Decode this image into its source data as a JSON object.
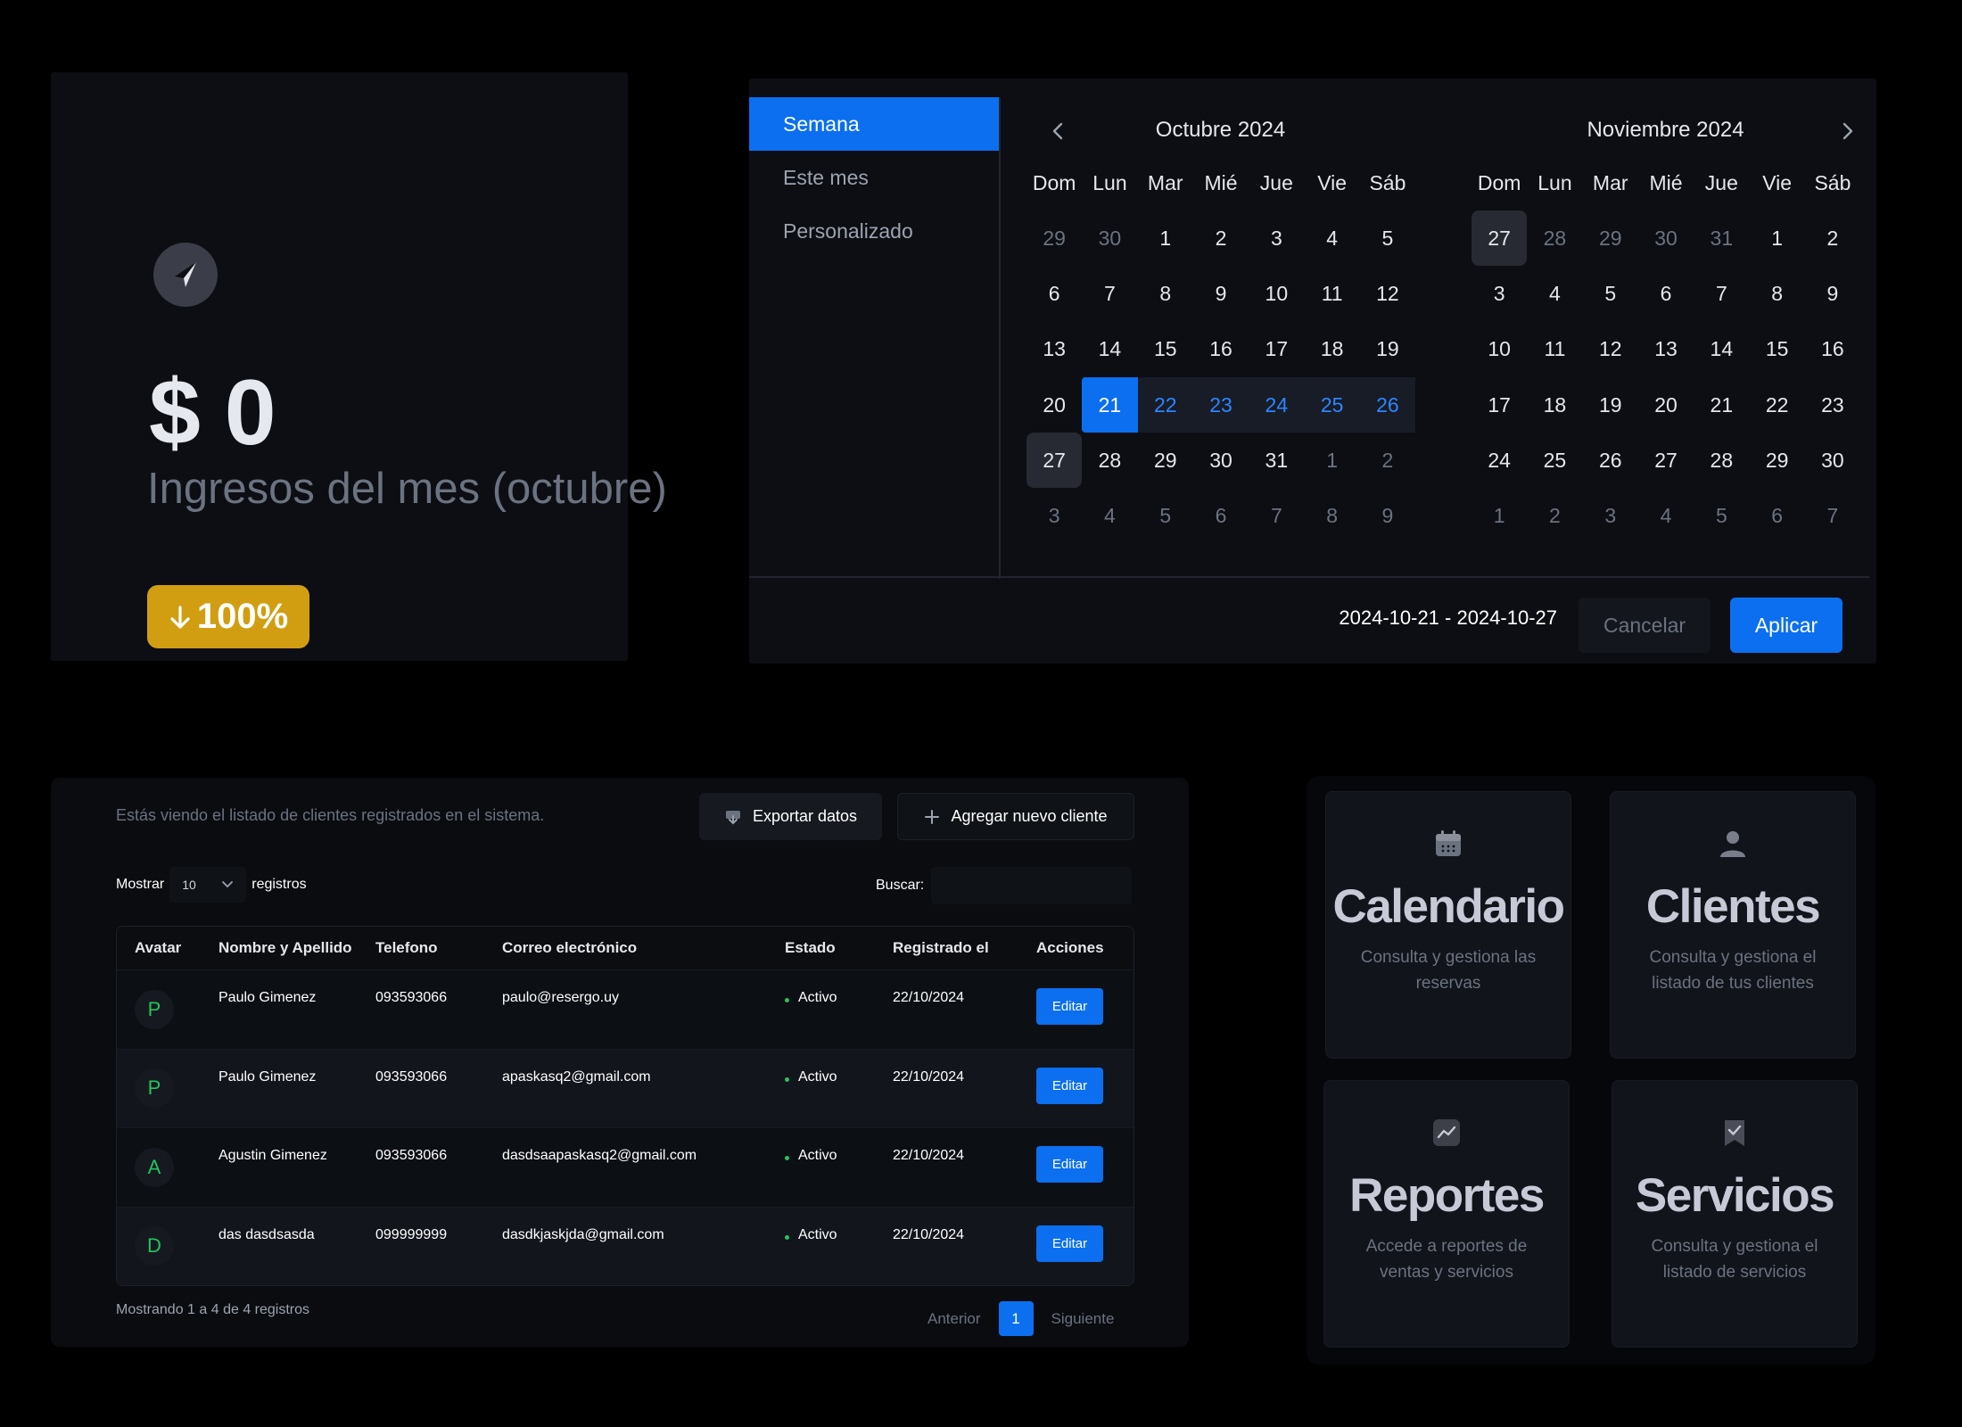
{
  "income": {
    "amount": "$ 0",
    "label": "Ingresos del mes (octubre)",
    "change": "100%",
    "change_direction": "down",
    "badge_color": "#d19e12"
  },
  "date_picker": {
    "presets": [
      {
        "label": "Semana",
        "active": true
      },
      {
        "label": "Este mes",
        "active": false
      },
      {
        "label": "Personalizado",
        "active": false
      }
    ],
    "weekdays": [
      "Dom",
      "Lun",
      "Mar",
      "Mié",
      "Jue",
      "Vie",
      "Sáb"
    ],
    "months": [
      {
        "title": "Octubre 2024",
        "weeks": [
          [
            {
              "d": "29",
              "s": "out"
            },
            {
              "d": "30",
              "s": "out"
            },
            {
              "d": "1"
            },
            {
              "d": "2"
            },
            {
              "d": "3"
            },
            {
              "d": "4"
            },
            {
              "d": "5"
            }
          ],
          [
            {
              "d": "6"
            },
            {
              "d": "7"
            },
            {
              "d": "8"
            },
            {
              "d": "9"
            },
            {
              "d": "10"
            },
            {
              "d": "11"
            },
            {
              "d": "12"
            }
          ],
          [
            {
              "d": "13"
            },
            {
              "d": "14"
            },
            {
              "d": "15"
            },
            {
              "d": "16"
            },
            {
              "d": "17"
            },
            {
              "d": "18"
            },
            {
              "d": "19"
            }
          ],
          [
            {
              "d": "20"
            },
            {
              "d": "21",
              "s": "sel"
            },
            {
              "d": "22",
              "s": "range"
            },
            {
              "d": "23",
              "s": "range"
            },
            {
              "d": "24",
              "s": "range"
            },
            {
              "d": "25",
              "s": "range"
            },
            {
              "d": "26",
              "s": "range"
            }
          ],
          [
            {
              "d": "27",
              "s": "today"
            },
            {
              "d": "28"
            },
            {
              "d": "29"
            },
            {
              "d": "30"
            },
            {
              "d": "31"
            },
            {
              "d": "1",
              "s": "out"
            },
            {
              "d": "2",
              "s": "out"
            }
          ],
          [
            {
              "d": "3",
              "s": "out"
            },
            {
              "d": "4",
              "s": "out"
            },
            {
              "d": "5",
              "s": "out"
            },
            {
              "d": "6",
              "s": "out"
            },
            {
              "d": "7",
              "s": "out"
            },
            {
              "d": "8",
              "s": "out"
            },
            {
              "d": "9",
              "s": "out"
            }
          ]
        ]
      },
      {
        "title": "Noviembre 2024",
        "weeks": [
          [
            {
              "d": "27",
              "s": "today"
            },
            {
              "d": "28",
              "s": "out"
            },
            {
              "d": "29",
              "s": "out"
            },
            {
              "d": "30",
              "s": "out"
            },
            {
              "d": "31",
              "s": "out"
            },
            {
              "d": "1"
            },
            {
              "d": "2"
            }
          ],
          [
            {
              "d": "3"
            },
            {
              "d": "4"
            },
            {
              "d": "5"
            },
            {
              "d": "6"
            },
            {
              "d": "7"
            },
            {
              "d": "8"
            },
            {
              "d": "9"
            }
          ],
          [
            {
              "d": "10"
            },
            {
              "d": "11"
            },
            {
              "d": "12"
            },
            {
              "d": "13"
            },
            {
              "d": "14"
            },
            {
              "d": "15"
            },
            {
              "d": "16"
            }
          ],
          [
            {
              "d": "17"
            },
            {
              "d": "18"
            },
            {
              "d": "19"
            },
            {
              "d": "20"
            },
            {
              "d": "21"
            },
            {
              "d": "22"
            },
            {
              "d": "23"
            }
          ],
          [
            {
              "d": "24"
            },
            {
              "d": "25"
            },
            {
              "d": "26"
            },
            {
              "d": "27"
            },
            {
              "d": "28"
            },
            {
              "d": "29"
            },
            {
              "d": "30"
            }
          ],
          [
            {
              "d": "1",
              "s": "out"
            },
            {
              "d": "2",
              "s": "out"
            },
            {
              "d": "3",
              "s": "out"
            },
            {
              "d": "4",
              "s": "out"
            },
            {
              "d": "5",
              "s": "out"
            },
            {
              "d": "6",
              "s": "out"
            },
            {
              "d": "7",
              "s": "out"
            }
          ]
        ]
      }
    ],
    "selected_range": "2024-10-21 - 2024-10-27",
    "cancel_label": "Cancelar",
    "apply_label": "Aplicar",
    "accent_color": "#0b6ff0"
  },
  "clients": {
    "description": "Estás viendo el listado de clientes registrados en el sistema.",
    "export_label": "Exportar datos",
    "add_label": "Agregar nuevo cliente",
    "show_label": "Mostrar",
    "show_value": "10",
    "records_label": "registros",
    "search_label": "Buscar:",
    "search_placeholder": "",
    "columns": [
      "Avatar",
      "Nombre y Apellido",
      "Telefono",
      "Correo electrónico",
      "Estado",
      "Registrado el",
      "Acciones"
    ],
    "rows": [
      {
        "initial": "P",
        "name": "Paulo Gimenez",
        "phone": "093593066",
        "email": "paulo@resergo.uy",
        "status": "Activo",
        "registered": "22/10/2024",
        "action": "Editar"
      },
      {
        "initial": "P",
        "name": "Paulo Gimenez",
        "phone": "093593066",
        "email": "apaskasq2@gmail.com",
        "status": "Activo",
        "registered": "22/10/2024",
        "action": "Editar"
      },
      {
        "initial": "A",
        "name": "Agustin Gimenez",
        "phone": "093593066",
        "email": "dasdsaapaskasq2@gmail.com",
        "status": "Activo",
        "registered": "22/10/2024",
        "action": "Editar"
      },
      {
        "initial": "D",
        "name": "das dasdsasda",
        "phone": "099999999",
        "email": "dasdkjaskjda@gmail.com",
        "status": "Activo",
        "registered": "22/10/2024",
        "action": "Editar"
      }
    ],
    "status_color": "#22c55e",
    "footer_info": "Mostrando 1 a 4 de 4 registros",
    "prev_label": "Anterior",
    "current_page": "1",
    "next_label": "Siguiente"
  },
  "features": [
    {
      "key": "cal",
      "icon": "calendar-icon",
      "title": "Calendario",
      "desc": "Consulta y gestiona las reservas"
    },
    {
      "key": "cli",
      "icon": "user-icon",
      "title": "Clientes",
      "desc": "Consulta y gestiona el listado de tus clientes"
    },
    {
      "key": "rep",
      "icon": "chart-icon",
      "title": "Reportes",
      "desc": "Accede a reportes de ventas y servicios"
    },
    {
      "key": "ser",
      "icon": "bookmark-check-icon",
      "title": "Servicios",
      "desc": "Consulta y gestiona el listado de servicios"
    }
  ]
}
